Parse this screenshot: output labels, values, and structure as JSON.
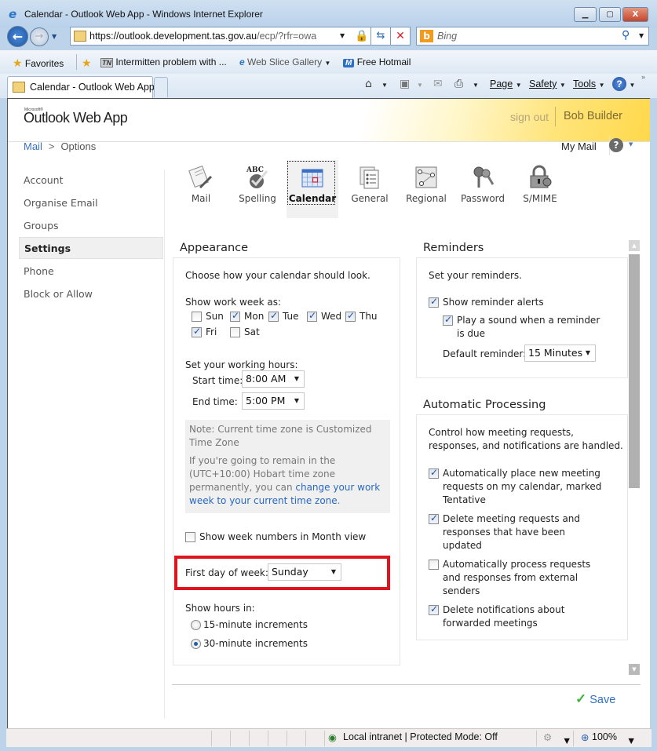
{
  "window": {
    "title": "Calendar - Outlook Web App - Windows Internet Explorer",
    "minimize_label": "▁",
    "maximize_label": "▢",
    "close_label": "X"
  },
  "browser": {
    "url_host": "https://outlook.development.tas.gov.au",
    "url_path": "/ecp/?rfr=owa",
    "search_placeholder": "Bing",
    "favorites": {
      "favorites_label": "Favorites",
      "items": [
        {
          "label": "Intermitten problem with ...",
          "icon": "tn-icon"
        },
        {
          "label": "Web Slice Gallery",
          "icon": "ie-icon"
        },
        {
          "label": "Free Hotmail",
          "icon": "hotmail-icon"
        }
      ]
    },
    "tab_title": "Calendar - Outlook Web App",
    "command_bar": {
      "page_label": "Page",
      "safety_label": "Safety",
      "tools_label": "Tools",
      "help_label": "?",
      "overflow_label": "»"
    }
  },
  "header": {
    "logo_small": "Microsoft®",
    "logo": "Outlook Web App",
    "signout_label": "sign out",
    "user_name": "Bob Builder",
    "breadcrumb": {
      "root": "Mail",
      "separator": ">",
      "current": "Options"
    },
    "mymail_label": "My Mail",
    "help_label": "?"
  },
  "sidebar": {
    "items": [
      {
        "label": "Account",
        "active": false
      },
      {
        "label": "Organise Email",
        "active": false
      },
      {
        "label": "Groups",
        "active": false
      },
      {
        "label": "Settings",
        "active": true
      },
      {
        "label": "Phone",
        "active": false
      },
      {
        "label": "Block or Allow",
        "active": false
      }
    ]
  },
  "categories": [
    {
      "label": "Mail",
      "icon": "mail-edit-icon",
      "active": false
    },
    {
      "label": "Spelling",
      "icon": "spelling-check-icon",
      "active": false
    },
    {
      "label": "Calendar",
      "icon": "calendar-icon",
      "active": true
    },
    {
      "label": "General",
      "icon": "general-list-icon",
      "active": false
    },
    {
      "label": "Regional",
      "icon": "regional-map-icon",
      "active": false
    },
    {
      "label": "Password",
      "icon": "keys-icon",
      "active": false
    },
    {
      "label": "S/MIME",
      "icon": "padlock-certificate-icon",
      "active": false
    }
  ],
  "appearance": {
    "title": "Appearance",
    "intro": "Choose how your calendar should look.",
    "work_week_label": "Show work week as:",
    "days": [
      {
        "label": "Sun",
        "checked": false
      },
      {
        "label": "Mon",
        "checked": true
      },
      {
        "label": "Tue",
        "checked": true
      },
      {
        "label": "Wed",
        "checked": true
      },
      {
        "label": "Thu",
        "checked": true
      },
      {
        "label": "Fri",
        "checked": true
      },
      {
        "label": "Sat",
        "checked": false
      }
    ],
    "working_hours_label": "Set your working hours:",
    "start_time_label": "Start time:",
    "start_time_value": "8:00 AM",
    "end_time_label": "End time:",
    "end_time_value": "5:00 PM",
    "note_line1": "Note: Current time zone is Customized Time Zone",
    "note_line2_prefix": "If you're going to remain in the (UTC+10:00) Hobart time zone permanently, you can ",
    "note_link": "change your work week to your current time zone",
    "note_suffix": ".",
    "week_numbers_label": "Show week numbers in Month view",
    "week_numbers_checked": false,
    "first_day_label": "First day of week:",
    "first_day_value": "Sunday",
    "show_hours_label": "Show hours in:",
    "increments": [
      {
        "label": "15-minute increments",
        "checked": false
      },
      {
        "label": "30-minute increments",
        "checked": true
      }
    ]
  },
  "reminders": {
    "title": "Reminders",
    "intro": "Set your reminders.",
    "show_alerts_label": "Show reminder alerts",
    "show_alerts_checked": true,
    "play_sound_label_1": "Play a sound when a reminder",
    "play_sound_label_2": "is due",
    "play_sound_checked": true,
    "default_reminder_label": "Default reminder:",
    "default_reminder_value": "15 Minutes"
  },
  "automatic_processing": {
    "title": "Automatic Processing",
    "intro_1": "Control how meeting requests,",
    "intro_2": "responses, and notifications are handled.",
    "options": [
      {
        "lines": [
          "Automatically place new meeting",
          "requests on my calendar, marked",
          "Tentative"
        ],
        "checked": true
      },
      {
        "lines": [
          "Delete meeting requests and",
          "responses that have been",
          "updated"
        ],
        "checked": true
      },
      {
        "lines": [
          "Automatically process requests",
          "and responses from external",
          "senders"
        ],
        "checked": false
      },
      {
        "lines": [
          "Delete notifications about",
          "forwarded meetings"
        ],
        "checked": true
      }
    ]
  },
  "footer": {
    "save_label": "Save"
  },
  "statusbar": {
    "zone_text": "Local intranet | Protected Mode: Off",
    "zoom_level": "100%"
  }
}
